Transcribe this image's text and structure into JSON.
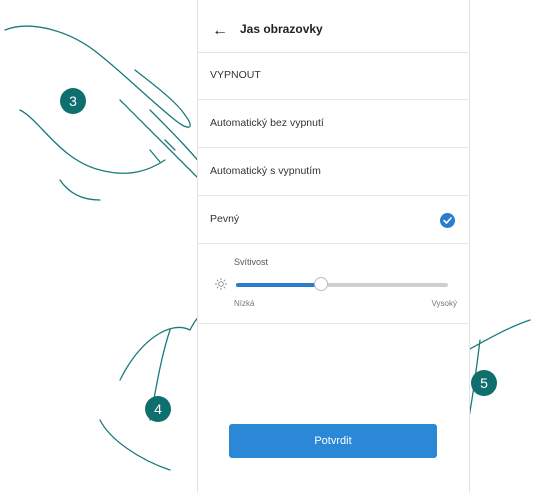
{
  "header": {
    "back_icon": "arrow-left-icon",
    "title": "Jas obrazovky"
  },
  "options": [
    {
      "label": "VYPNOUT",
      "selected": false
    },
    {
      "label": "Automatický bez vypnutí",
      "selected": false
    },
    {
      "label": "Automatický s vypnutím",
      "selected": false
    },
    {
      "label": "Pevný",
      "selected": true
    }
  ],
  "brightness": {
    "label": "Svítivost",
    "icon": "sun-icon",
    "low_label": "Nízká",
    "high_label": "Vysoký",
    "value": 0.4
  },
  "confirm_label": "Potvrdit",
  "steps": [
    "3",
    "4",
    "5"
  ],
  "colors": {
    "accent": "#2a7ccf",
    "button": "#2a88d6",
    "marker": "#0f6f6e"
  }
}
